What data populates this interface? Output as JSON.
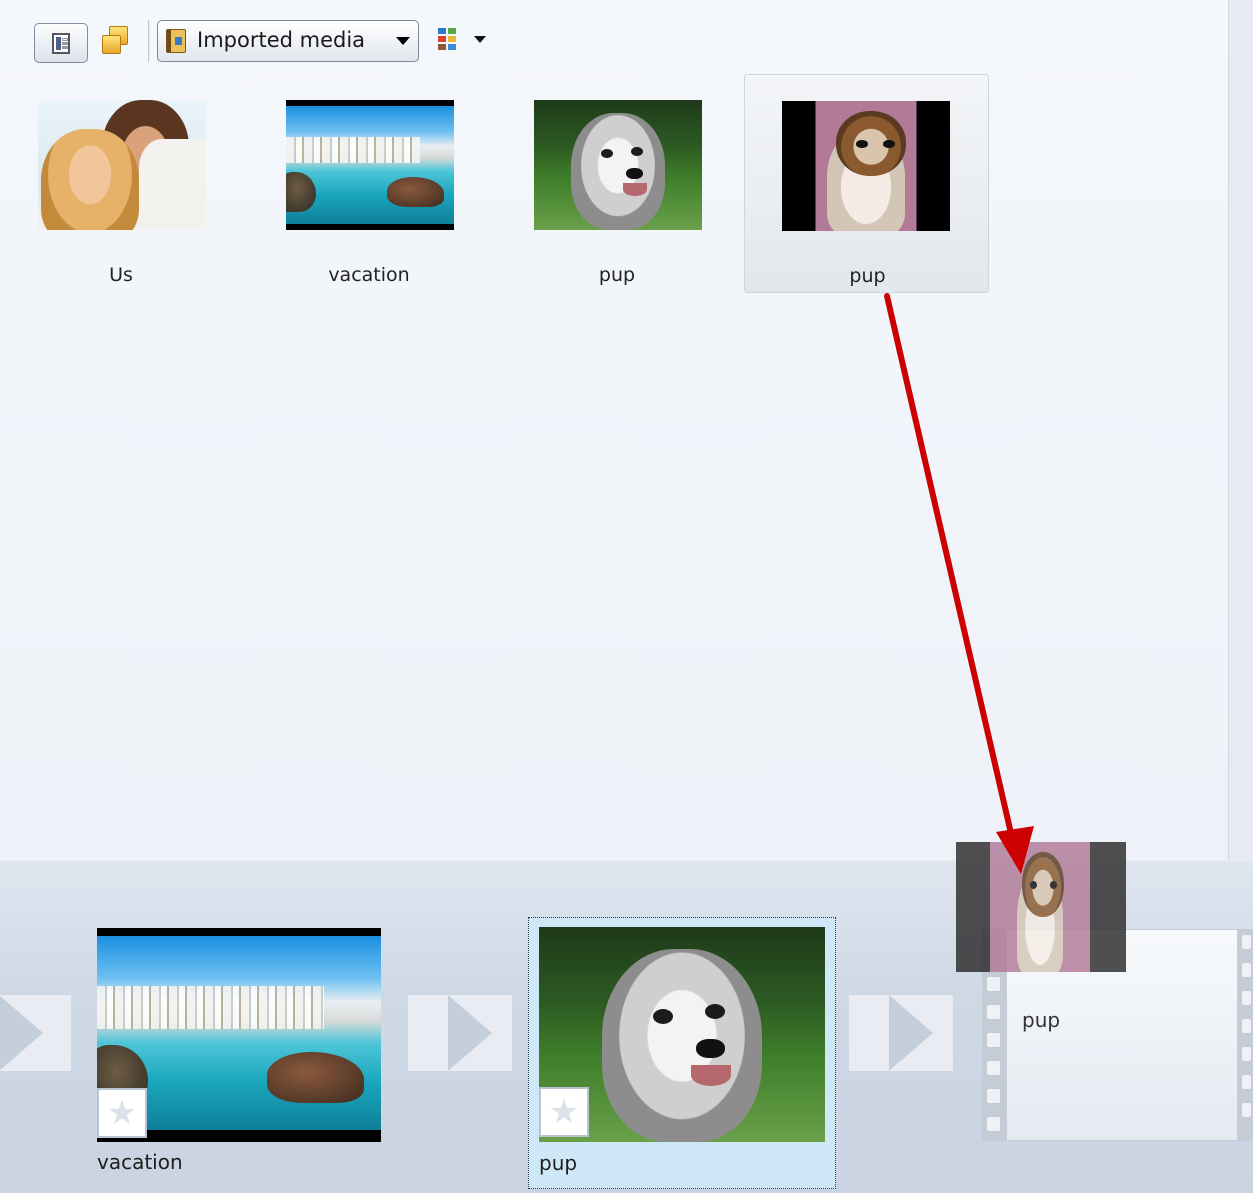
{
  "toolbar": {
    "collection_dropdown_value": "Imported media"
  },
  "library": {
    "items": [
      {
        "label": "Us",
        "thumbnail": "couple-photo",
        "selected": false
      },
      {
        "label": "vacation",
        "thumbnail": "beach-photo",
        "selected": false
      },
      {
        "label": "pup",
        "thumbnail": "dog-photo",
        "selected": false
      },
      {
        "label": "pup",
        "thumbnail": "dog-video",
        "selected": true
      }
    ]
  },
  "storyboard": {
    "clips": [
      {
        "label": "vacation",
        "thumbnail": "beach-photo"
      },
      {
        "label": "pup",
        "thumbnail": "dog-photo",
        "focused": true
      }
    ],
    "drop_target_label": "pup"
  },
  "colors": {
    "arrow": "#cc0000",
    "selected_clip_bg": "#cfe8f7"
  }
}
